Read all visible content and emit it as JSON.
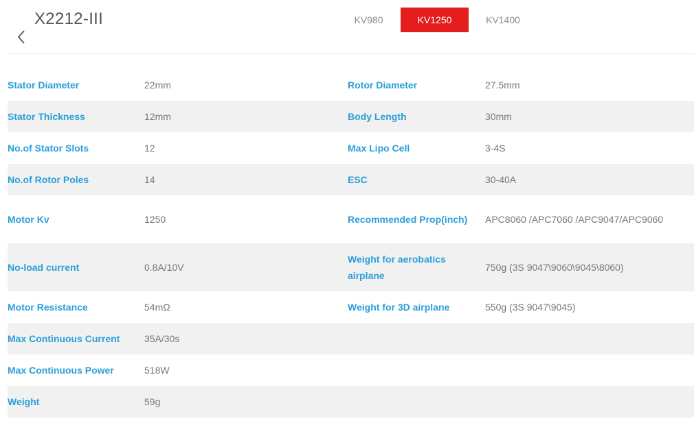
{
  "header": {
    "title": "X2212-III",
    "tabs": [
      "KV980",
      "KV1250",
      "KV1400"
    ],
    "active_tab": "KV1250",
    "accent_color": "#e31c1c",
    "label_color": "#2a9fd8"
  },
  "specs": [
    {
      "l1": "Stator Diameter",
      "v1": "22mm",
      "l2": "Rotor Diameter",
      "v2": "27.5mm"
    },
    {
      "l1": "Stator Thickness",
      "v1": "12mm",
      "l2": "Body Length",
      "v2": "30mm"
    },
    {
      "l1": "No.of Stator Slots",
      "v1": "12",
      "l2": "Max Lipo Cell",
      "v2": "3-4S"
    },
    {
      "l1": "No.of Rotor Poles",
      "v1": "14",
      "l2": "ESC",
      "v2": "30-40A"
    },
    {
      "l1": "Motor Kv",
      "v1": "1250",
      "l2": "Recommended Prop(inch)",
      "v2": "APC8060 /APC7060 /APC9047/APC9060"
    },
    {
      "l1": "No-load current",
      "v1": "0.8A/10V",
      "l2": "Weight for aerobatics airplane",
      "v2": "750g (3S 9047\\9060\\9045\\8060)"
    },
    {
      "l1": "Motor Resistance",
      "v1": "54mΩ",
      "l2": "Weight for 3D airplane",
      "v2": "550g (3S 9047\\9045)"
    },
    {
      "l1": "Max Continuous Current",
      "v1": "35A/30s",
      "l2": "",
      "v2": ""
    },
    {
      "l1": "Max Continuous Power",
      "v1": "518W",
      "l2": "",
      "v2": ""
    },
    {
      "l1": "Weight",
      "v1": "59g",
      "l2": "",
      "v2": ""
    }
  ]
}
